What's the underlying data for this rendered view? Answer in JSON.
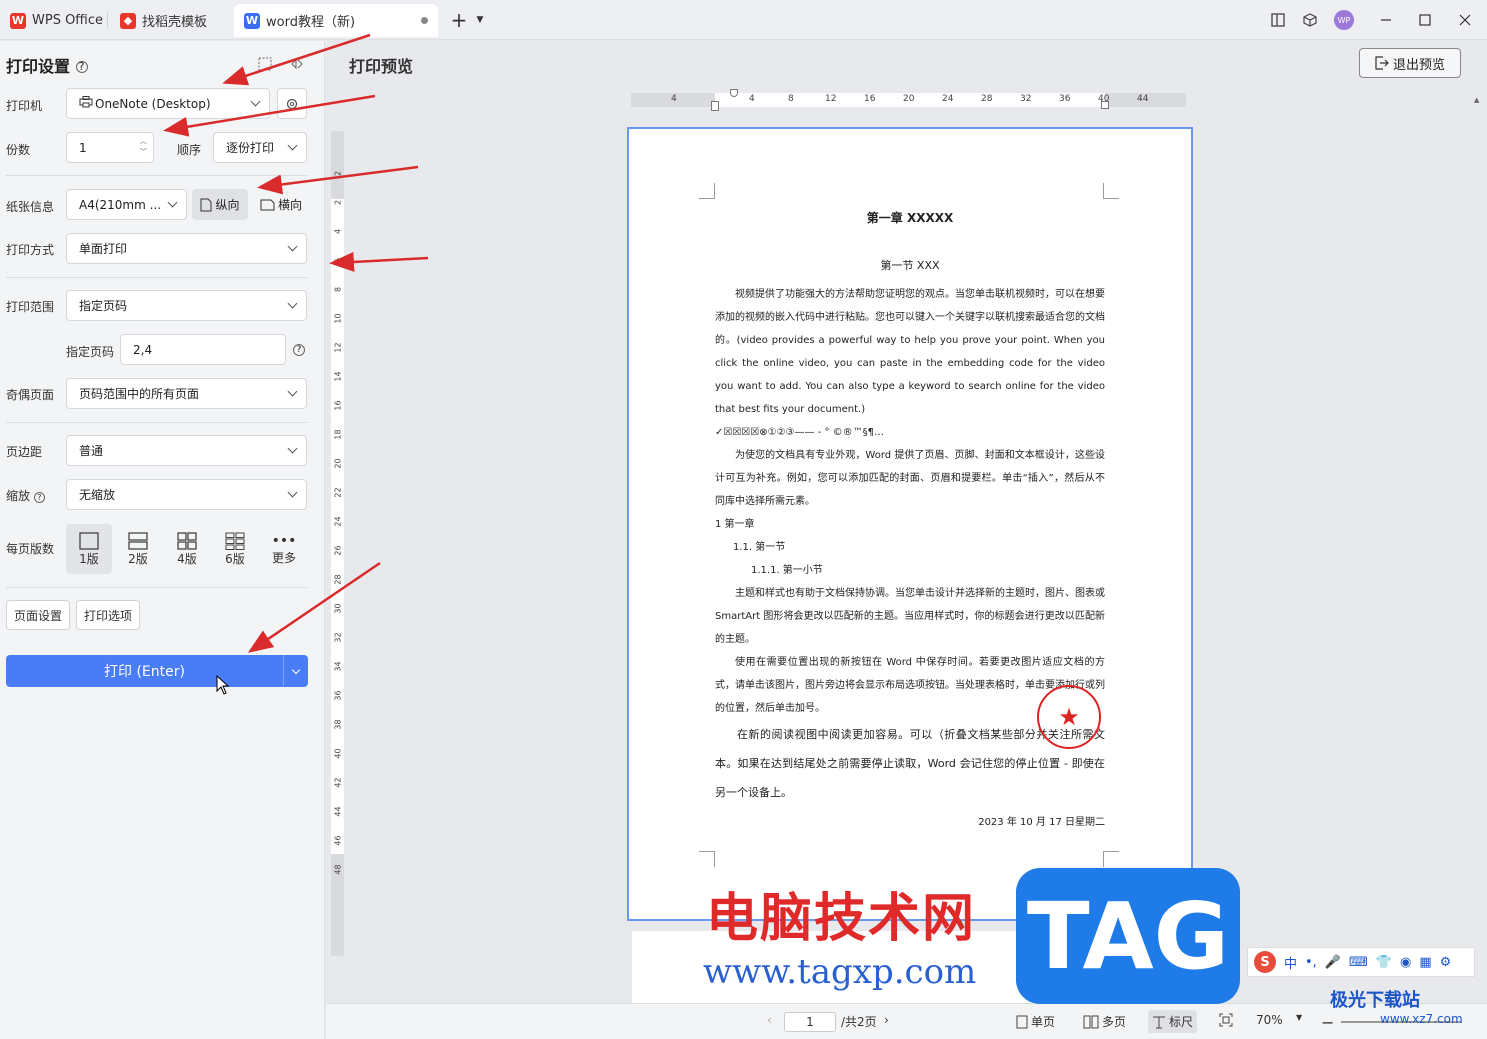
{
  "titlebar": {
    "tabs": [
      {
        "label": "WPS Office"
      },
      {
        "label": "找稻壳模板"
      },
      {
        "label": "word教程（新)"
      }
    ],
    "avatar": "WP"
  },
  "panel": {
    "title": "打印设置",
    "printer_label": "打印机",
    "printer_value": "OneNote (Desktop)",
    "copies_label": "份数",
    "copies_value": "1",
    "order_label": "顺序",
    "order_value": "逐份打印",
    "paper_label": "纸张信息",
    "paper_value": "A4(210mm ...",
    "portrait": "纵向",
    "landscape": "横向",
    "mode_label": "打印方式",
    "mode_value": "单面打印",
    "range_label": "打印范围",
    "range_value": "指定页码",
    "pages_label": "指定页码",
    "pages_value": "2,4",
    "oddeven_label": "奇偶页面",
    "oddeven_value": "页码范围中的所有页面",
    "margin_label": "页边距",
    "margin_value": "普通",
    "zoom_label": "缩放",
    "zoom_value": "无缩放",
    "perpage_label": "每页版数",
    "layouts": [
      "1版",
      "2版",
      "4版",
      "6版",
      "更多"
    ],
    "page_setup": "页面设置",
    "print_options": "打印选项",
    "print_button": "打印 (Enter)"
  },
  "preview": {
    "title": "打印预览",
    "exit": "退出预览",
    "ruler_ticks": [
      "4",
      "4",
      "8",
      "12",
      "16",
      "20",
      "24",
      "28",
      "32",
      "36",
      "40",
      "44"
    ],
    "vruler_ticks": [
      "2",
      "2",
      "4",
      "6",
      "8",
      "10",
      "12",
      "14",
      "16",
      "18",
      "20",
      "22",
      "24",
      "26",
      "28",
      "30",
      "32",
      "34",
      "36",
      "38",
      "40",
      "42",
      "44",
      "46",
      "48"
    ]
  },
  "doc": {
    "h1": "第一章  XXXXX",
    "h2": "第一节  XXX",
    "p1": "视频提供了功能强大的方法帮助您证明您的观点。当您单击联机视频时，可以在想要添加的视频的嵌入代码中进行粘贴。您也可以键入一个关键字以联机搜索最适合您的文档的。(video provides a powerful way to help you prove your point. When you click the online video, you can paste in the embedding code for the video you want to add. You can also type a keyword to search online for the video that best fits your document.)",
    "symbols": "✓☒☒☒☒⊗①②③——  -    °   ©®™§¶…",
    "p2": "为使您的文档具有专业外观，Word 提供了页眉、页脚、封面和文本框设计，这些设计可互为补充。例如，您可以添加匹配的封面、页眉和提要栏。单击“插入”，然后从不同库中选择所需元素。",
    "l1": "1    第一章",
    "l2": "1.1.  第一节",
    "l3": "1.1.1.    第一小节",
    "p3": "主题和样式也有助于文档保持协调。当您单击设计并选择新的主题时，图片、图表或 SmartArt 图形将会更改以匹配新的主题。当应用样式时，你的标题会进行更改以匹配新的主题。",
    "p4": "使用在需要位置出现的新按钮在 Word 中保存时间。若要更改图片适应文档的方式，请单击该图片，图片旁边将会显示布局选项按钮。当处理表格时，单击要添加行或列的位置，然后单击加号。",
    "p5": "在新的阅读视图中阅读更加容易。可以（折叠文档某些部分并关注所需文本。如果在达到结尾处之前需要停止读取，Word 会记住您的停止位置 - 即使在另一个设备上。",
    "date": "2023 年 10 月 17 日星期二"
  },
  "status": {
    "page": "1",
    "total": "/共2页",
    "single": "单页",
    "multi": "多页",
    "ruler": "标尺",
    "zoom": "70%"
  },
  "watermark": {
    "cn": "电脑技术网",
    "url": "www.tagxp.com",
    "tag": "TAG",
    "site2": "极光下载站",
    "site2_url": "www.xz7.com"
  },
  "ime": {
    "label": "中",
    "logo": "S"
  }
}
